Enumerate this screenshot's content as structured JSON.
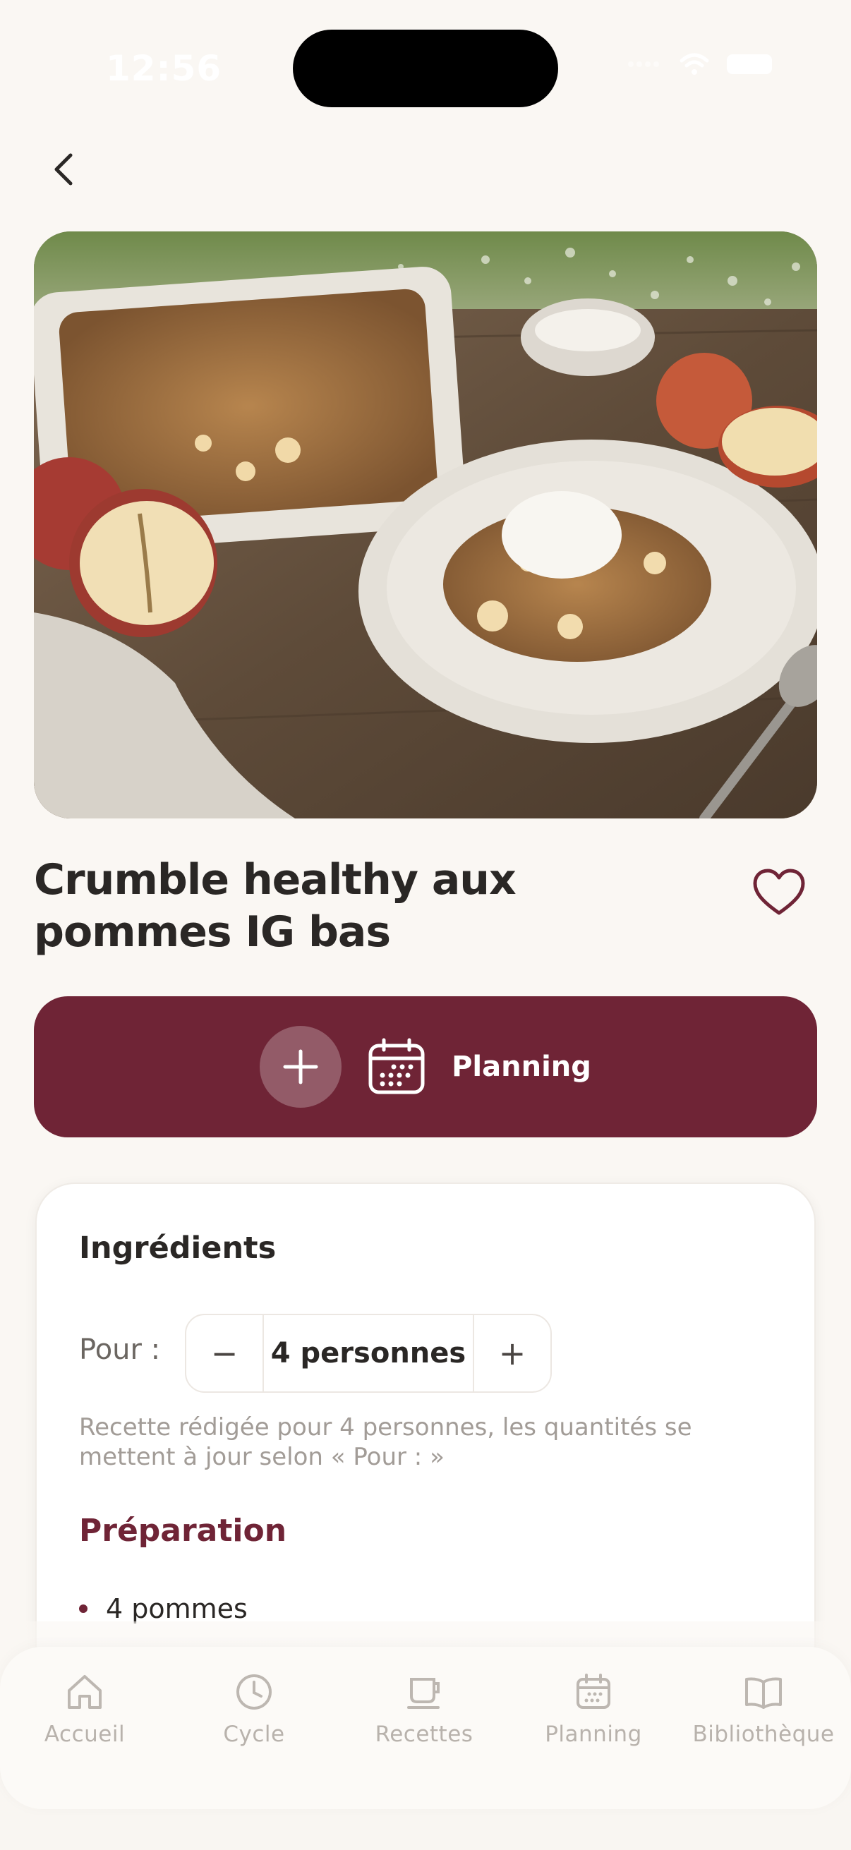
{
  "status_bar": {
    "time": "12:56"
  },
  "recipe": {
    "title": "Crumble healthy aux pommes IG bas",
    "image_alt": "Crumble aux pommes"
  },
  "actions": {
    "planning_label": "Planning"
  },
  "ingredients": {
    "heading": "Ingrédients",
    "pour_label": "Pour :",
    "stepper_minus": "−",
    "stepper_value": "4 personnes",
    "stepper_plus": "+",
    "note": "Recette rédigée pour 4 personnes, les quantités se mettent à jour selon « Pour : »",
    "section_heading": "Préparation",
    "items": [
      {
        "text": "4 pommes"
      }
    ]
  },
  "nav": {
    "items": [
      {
        "label": "Accueil",
        "icon": "home-icon"
      },
      {
        "label": "Cycle",
        "icon": "clock-icon"
      },
      {
        "label": "Recettes",
        "icon": "cup-icon"
      },
      {
        "label": "Planning",
        "icon": "calendar-icon"
      },
      {
        "label": "Bibliothèque",
        "icon": "book-icon"
      }
    ]
  },
  "colors": {
    "accent": "#6f2436",
    "background": "#faf7f3",
    "card": "#ffffff",
    "muted_text": "#a29c97"
  }
}
